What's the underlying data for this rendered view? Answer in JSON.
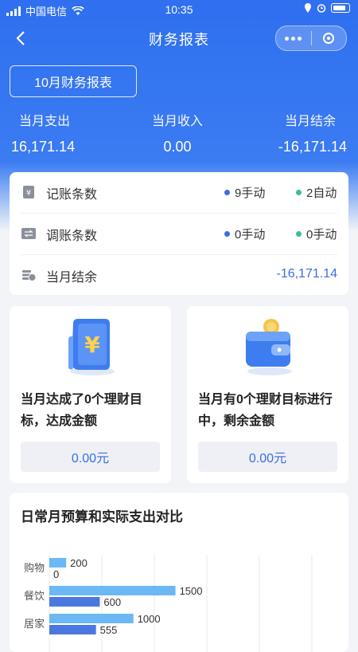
{
  "status_bar": {
    "carrier": "中国电信",
    "time": "10:35"
  },
  "navbar": {
    "title": "财务报表"
  },
  "month_button": "10月财务报表",
  "summary": [
    {
      "label": "当月支出",
      "value": "16,171.14"
    },
    {
      "label": "当月收入",
      "value": "0.00"
    },
    {
      "label": "当月结余",
      "value": "-16,171.14"
    }
  ],
  "stats": {
    "records": {
      "label": "记账条数",
      "manual": "9手动",
      "auto": "2自动"
    },
    "adjust": {
      "label": "调账条数",
      "manual": "0手动",
      "auto": "0手动"
    },
    "balance": {
      "label": "当月结余",
      "value": "-16,171.14"
    }
  },
  "goals": [
    {
      "text": "当月达成了0个理财目标，达成金额",
      "amount": "0.00元"
    },
    {
      "text": "当月有0个理财目标进行中，剩余金额",
      "amount": "0.00元"
    }
  ],
  "budget": {
    "title": "日常月预算和实际支出对比"
  },
  "colors": {
    "primary": "#2f6ff0",
    "manual_dot": "#3a6fe0",
    "auto_dot": "#3fbf8a",
    "budget_bar": "#6cb8f5",
    "actual_bar": "#4a78e0"
  },
  "chart_data": {
    "type": "bar",
    "orientation": "horizontal",
    "categories": [
      "购物",
      "餐饮",
      "居家"
    ],
    "series": [
      {
        "values": [
          200,
          1500,
          1000
        ]
      },
      {
        "values": [
          0,
          600,
          555
        ]
      }
    ],
    "xlim": [
      0,
      3500
    ]
  }
}
